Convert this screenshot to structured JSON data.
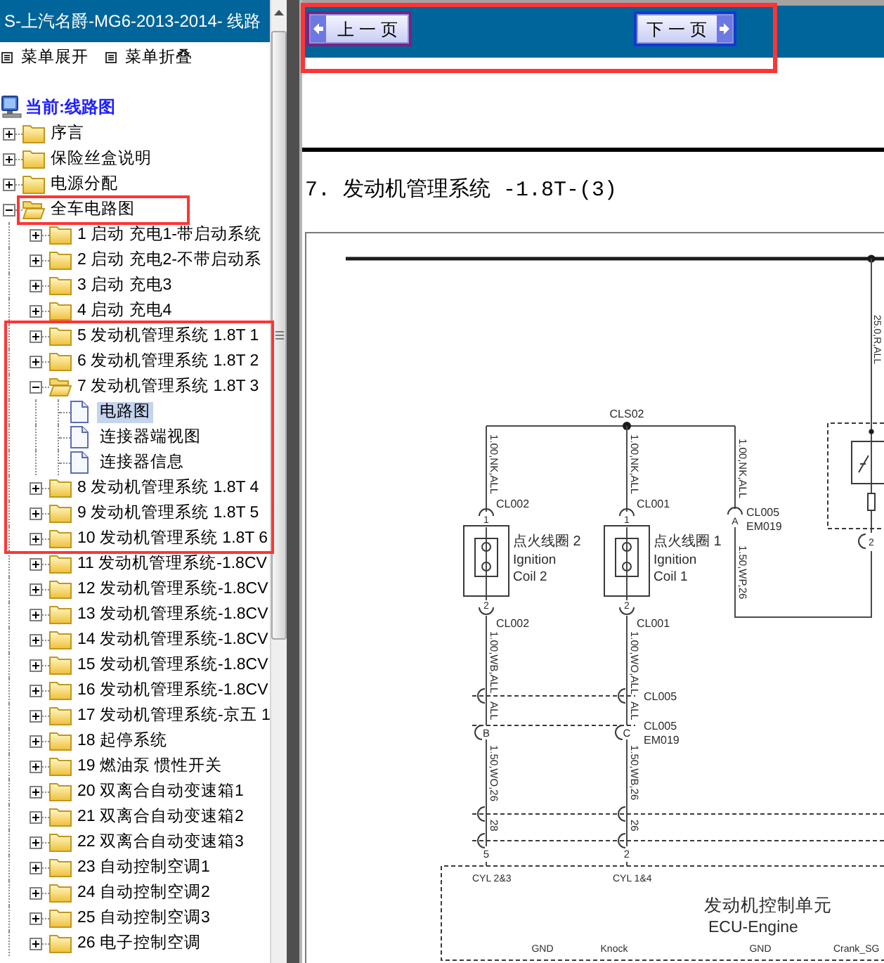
{
  "sidebar": {
    "title": "S-上汽名爵-MG6-2013-2014- 线路",
    "menu_buttons": [
      {
        "label": "菜单展开"
      },
      {
        "label": "菜单折叠"
      }
    ],
    "current": "当前:线路图",
    "tree": [
      {
        "label": "序言",
        "kind": "folder",
        "expanded": false
      },
      {
        "label": "保险丝盒说明",
        "kind": "folder",
        "expanded": false
      },
      {
        "label": "电源分配",
        "kind": "folder",
        "expanded": false
      },
      {
        "label": "全车电路图",
        "kind": "folder",
        "expanded": true,
        "children": [
          {
            "label": "1 启动 充电1-带启动系统",
            "kind": "folder",
            "expanded": false
          },
          {
            "label": "2 启动 充电2-不带启动系",
            "kind": "folder",
            "expanded": false
          },
          {
            "label": "3 启动 充电3",
            "kind": "folder",
            "expanded": false
          },
          {
            "label": "4 启动 充电4",
            "kind": "folder",
            "expanded": false
          },
          {
            "label": "5 发动机管理系统 1.8T 1",
            "kind": "folder",
            "expanded": false
          },
          {
            "label": "6 发动机管理系统 1.8T 2",
            "kind": "folder",
            "expanded": false
          },
          {
            "label": "7 发动机管理系统 1.8T 3",
            "kind": "folder",
            "expanded": true,
            "children": [
              {
                "label": "电路图",
                "kind": "page",
                "selected": true
              },
              {
                "label": "连接器端视图",
                "kind": "page",
                "selected": false
              },
              {
                "label": "连接器信息",
                "kind": "page",
                "selected": false
              }
            ]
          },
          {
            "label": "8 发动机管理系统 1.8T 4",
            "kind": "folder",
            "expanded": false
          },
          {
            "label": "9 发动机管理系统 1.8T 5",
            "kind": "folder",
            "expanded": false
          },
          {
            "label": "10 发动机管理系统 1.8T 6",
            "kind": "folder",
            "expanded": false
          },
          {
            "label": "11 发动机管理系统-1.8CV",
            "kind": "folder",
            "expanded": false
          },
          {
            "label": "12 发动机管理系统-1.8CV",
            "kind": "folder",
            "expanded": false
          },
          {
            "label": "13 发动机管理系统-1.8CV",
            "kind": "folder",
            "expanded": false
          },
          {
            "label": "14 发动机管理系统-1.8CV",
            "kind": "folder",
            "expanded": false
          },
          {
            "label": "15 发动机管理系统-1.8CV",
            "kind": "folder",
            "expanded": false
          },
          {
            "label": "16 发动机管理系统-1.8CV",
            "kind": "folder",
            "expanded": false
          },
          {
            "label": "17 发动机管理系统-京五 1",
            "kind": "folder",
            "expanded": false
          },
          {
            "label": "18 起停系统",
            "kind": "folder",
            "expanded": false
          },
          {
            "label": "19 燃油泵 惯性开关",
            "kind": "folder",
            "expanded": false
          },
          {
            "label": "20 双离合自动变速箱1",
            "kind": "folder",
            "expanded": false
          },
          {
            "label": "21 双离合自动变速箱2",
            "kind": "folder",
            "expanded": false
          },
          {
            "label": "22 双离合自动变速箱3",
            "kind": "folder",
            "expanded": false
          },
          {
            "label": "23 自动控制空调1",
            "kind": "folder",
            "expanded": false
          },
          {
            "label": "24 自动控制空调2",
            "kind": "folder",
            "expanded": false
          },
          {
            "label": "25 自动控制空调3",
            "kind": "folder",
            "expanded": false
          },
          {
            "label": "26 电子控制空调",
            "kind": "folder",
            "expanded": false
          }
        ]
      }
    ]
  },
  "pager": {
    "buttons": [
      {
        "label": "上 一 页",
        "kind": "prev"
      },
      {
        "label": "下 一 页",
        "kind": "next"
      }
    ]
  },
  "document": {
    "title": "7. 发动机管理系统 -1.8T-(3)",
    "diagram": {
      "feed_wire": "25.0,R,ALL",
      "splice": "CLS02",
      "coils": [
        {
          "wire_in": "1.00,NK,ALL",
          "pin_in": "1",
          "connector_in": "CL002",
          "name": "点火线圈 2",
          "name_en": [
            "Ignition",
            "Coil 2"
          ],
          "pin_out": "2",
          "connector_out": "CL002",
          "wire_out": "1.00,WB,ALL",
          "wire_link": "ALL",
          "inline_pin": "B",
          "wire_ecu": "1.50,WO,26",
          "wire_stub": "28",
          "ecu_pin": "5",
          "ecu_signal": "CYL 2&3"
        },
        {
          "wire_in": "1.00,NK,ALL",
          "pin_in": "1",
          "connector_in": "CL001",
          "name": "点火线圈 1",
          "name_en": [
            "Ignition",
            "Coil 1"
          ],
          "pin_out": "2",
          "connector_out": "CL001",
          "wire_out": "1.00,WO,ALL",
          "wire_link": "ALL",
          "inline_pin": "C",
          "wire_ecu": "1.50,WB,26",
          "wire_stub": "26",
          "ecu_pin": "2",
          "ecu_signal": "CYL 1&4"
        }
      ],
      "link_connector": "CL005",
      "inline_connector": [
        "CL005",
        "EM019"
      ],
      "branch": {
        "wire_in": "1.00,NK,ALL",
        "pin": "A",
        "connector": [
          "CL005",
          "EM019"
        ],
        "wire_out": "1.50,WP,26",
        "relay_pin": "2"
      },
      "ecu": {
        "name": "发动机控制单元",
        "name_en": "ECU-Engine",
        "pins": [
          "GND",
          "Knock",
          "GND",
          "Crank_SG"
        ]
      }
    }
  }
}
